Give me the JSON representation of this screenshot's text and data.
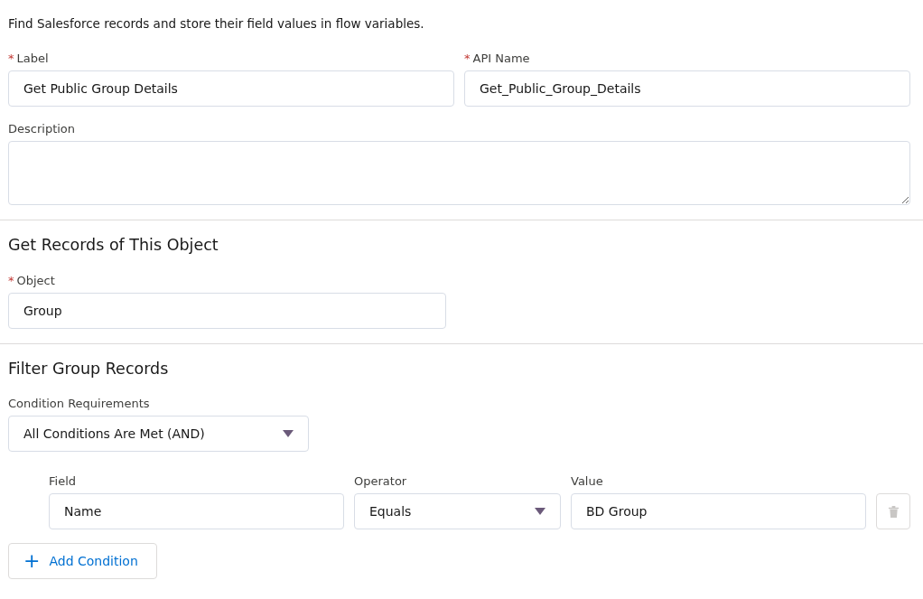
{
  "intro": "Find Salesforce records and store their field values in flow variables.",
  "label_field": {
    "label": "Label",
    "required_mark": "*",
    "value": "Get Public Group Details"
  },
  "api_name_field": {
    "label": "API Name",
    "required_mark": "*",
    "value": "Get_Public_Group_Details"
  },
  "description_field": {
    "label": "Description"
  },
  "object_section": {
    "heading": "Get Records of This Object",
    "object_field": {
      "label": "Object",
      "required_mark": "*",
      "value": "Group"
    }
  },
  "filter_section": {
    "heading": "Filter Group Records",
    "condition_requirements": {
      "label": "Condition Requirements",
      "value": "All Conditions Are Met (AND)"
    },
    "conditions": [
      {
        "field_label": "Field",
        "field": "Name",
        "operator_label": "Operator",
        "operator": "Equals",
        "value_label": "Value",
        "value": "BD Group",
        "delete_disabled": true
      }
    ],
    "add_button": {
      "label": "Add Condition",
      "icon": "+"
    }
  }
}
